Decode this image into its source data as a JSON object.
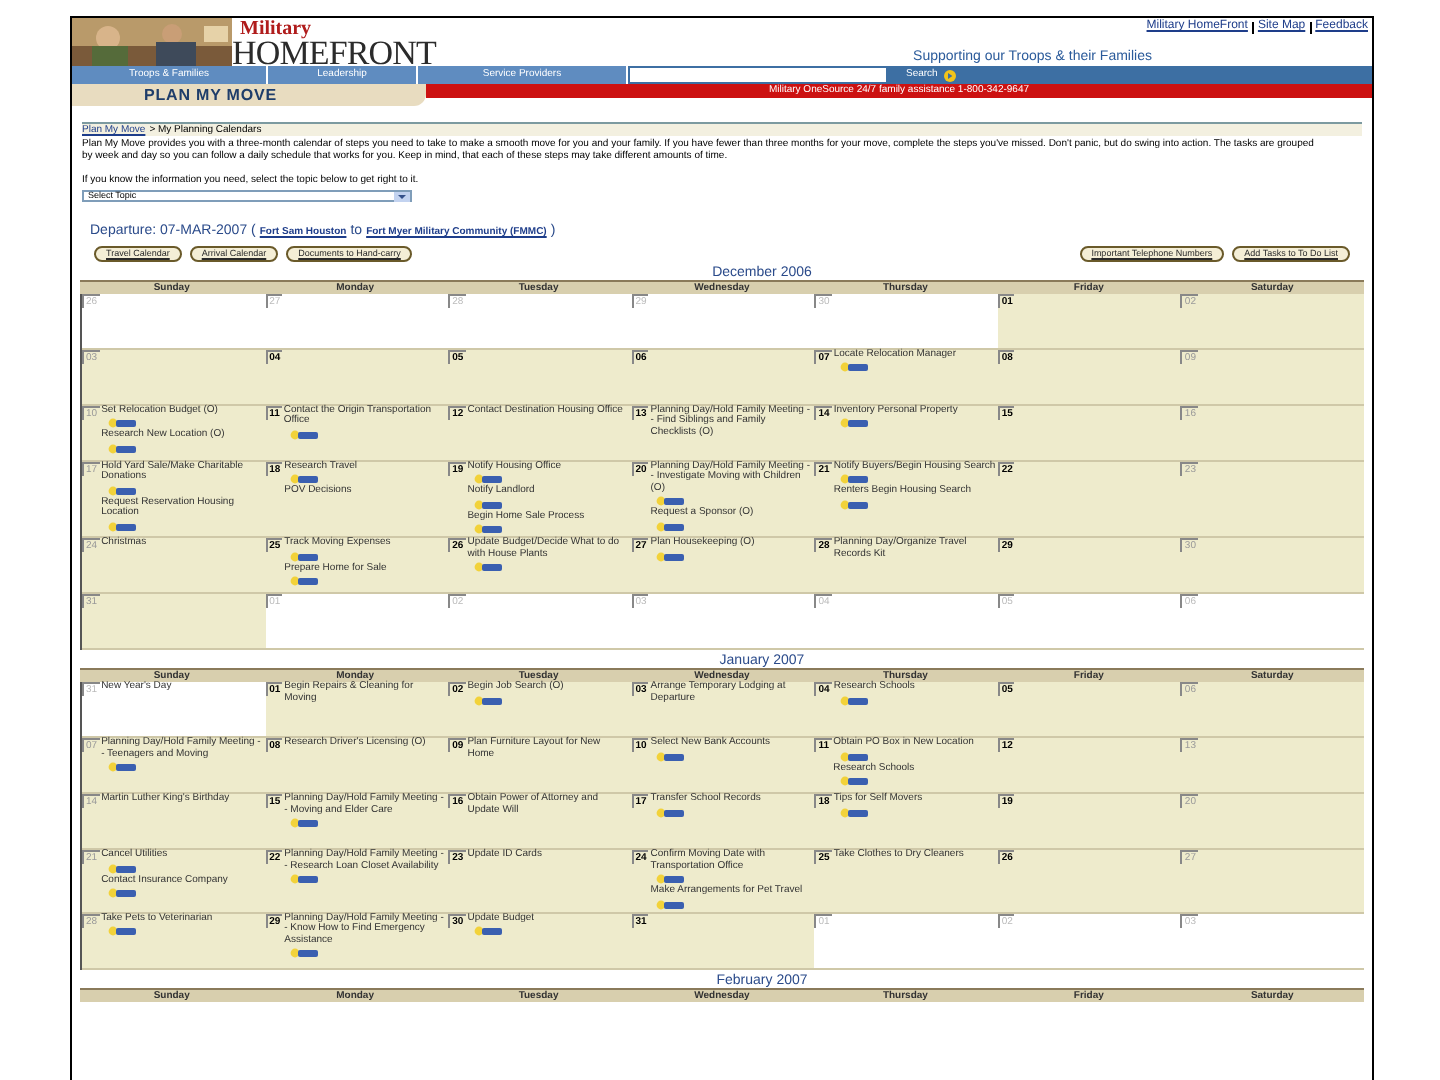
{
  "header": {
    "logo_top": "Military",
    "logo_main": "HOMEFRONT",
    "top_links": [
      "Military HomeFront",
      "Site Map",
      "Feedback"
    ],
    "tagline": "Supporting our Troops & their Families",
    "nav": [
      "Troops & Families",
      "Leadership",
      "Service Providers"
    ],
    "search_button": "Search",
    "section_title": "PLAN MY MOVE",
    "hotline": "Military OneSource 24/7 family assistance 1-800-342-9647"
  },
  "breadcrumb": {
    "link": "Plan My Move",
    "current": "> My Planning Calendars"
  },
  "intro": "Plan My Move provides you with a three-month calendar of steps you need to take to make a smooth move for you and your family. If you have fewer than three months for your move, complete the steps you've missed. Don't panic, but do swing into action. The tasks are grouped by week and day so you can follow a daily schedule that works for you. Keep in mind, that each of these steps may take different amounts of time.",
  "topic_prompt": "If you know the information you need, select the topic below to get right to it.",
  "topic_select": "Select Topic",
  "departure": {
    "label": "Departure: 07-MAR-2007 (",
    "origin": "Fort Sam Houston",
    "to": "to",
    "destination": "Fort Myer Military Community (FMMC)",
    "close": ")"
  },
  "buttons_left": [
    "Travel Calendar",
    "Arrival Calendar",
    "Documents to Hand-carry"
  ],
  "buttons_right": [
    "Important Telephone Numbers",
    "Add Tasks to To Do List"
  ],
  "calendars": [
    {
      "title": "December 2006",
      "weekdays": [
        "Sunday",
        "Monday",
        "Tuesday",
        "Wednesday",
        "Thursday",
        "Friday",
        "Saturday"
      ],
      "weeks": [
        [
          {
            "number": "26",
            "kind": "outside"
          },
          {
            "number": "27",
            "kind": "outside"
          },
          {
            "number": "28",
            "kind": "outside"
          },
          {
            "number": "29",
            "kind": "outside"
          },
          {
            "number": "30",
            "kind": "outside"
          },
          {
            "number": "01",
            "kind": "weekday"
          },
          {
            "number": "02",
            "kind": "weekend"
          }
        ],
        [
          {
            "number": "03",
            "kind": "weekend"
          },
          {
            "number": "04",
            "kind": "weekday"
          },
          {
            "number": "05",
            "kind": "weekday"
          },
          {
            "number": "06",
            "kind": "weekday"
          },
          {
            "number": "07",
            "kind": "weekday",
            "events": [
              {
                "text": "Locate Relocation Manager",
                "more": true
              }
            ]
          },
          {
            "number": "08",
            "kind": "weekday"
          },
          {
            "number": "09",
            "kind": "weekend"
          }
        ],
        [
          {
            "number": "10",
            "kind": "weekend",
            "events": [
              {
                "text": "Set Relocation Budget (O)",
                "more": true
              },
              {
                "text": "Research New Location (O)",
                "more": true
              }
            ]
          },
          {
            "number": "11",
            "kind": "weekday",
            "events": [
              {
                "text": "Contact the Origin Transportation Office",
                "more": true
              }
            ]
          },
          {
            "number": "12",
            "kind": "weekday",
            "events": [
              {
                "text": "Contact Destination Housing Office",
                "more": false
              }
            ]
          },
          {
            "number": "13",
            "kind": "weekday",
            "events": [
              {
                "text": "Planning Day/Hold Family Meeting -- Find Siblings and Family Checklists (O)",
                "more": false
              }
            ]
          },
          {
            "number": "14",
            "kind": "weekday",
            "events": [
              {
                "text": "Inventory Personal Property",
                "more": true
              }
            ]
          },
          {
            "number": "15",
            "kind": "weekday"
          },
          {
            "number": "16",
            "kind": "weekend"
          }
        ],
        [
          {
            "number": "17",
            "kind": "weekend",
            "events": [
              {
                "text": "Hold Yard Sale/Make Charitable Donations",
                "more": true
              },
              {
                "text": "Request Reservation Housing Location",
                "more": true
              }
            ]
          },
          {
            "number": "18",
            "kind": "weekday",
            "events": [
              {
                "text": "Research Travel",
                "more": true
              },
              {
                "text": "POV Decisions",
                "more": false
              }
            ]
          },
          {
            "number": "19",
            "kind": "weekday",
            "events": [
              {
                "text": "Notify Housing Office",
                "more": true
              },
              {
                "text": "Notify Landlord",
                "more": true
              },
              {
                "text": "Begin Home Sale Process",
                "more": true
              }
            ]
          },
          {
            "number": "20",
            "kind": "weekday",
            "events": [
              {
                "text": "Planning Day/Hold Family Meeting -- Investigate Moving with Children (O)",
                "more": true
              },
              {
                "text": "Request a Sponsor (O)",
                "more": true
              }
            ]
          },
          {
            "number": "21",
            "kind": "weekday",
            "events": [
              {
                "text": "Notify Buyers/Begin Housing Search",
                "more": true
              },
              {
                "text": "Renters Begin Housing Search",
                "more": true
              }
            ]
          },
          {
            "number": "22",
            "kind": "weekday"
          },
          {
            "number": "23",
            "kind": "weekend"
          }
        ],
        [
          {
            "number": "24",
            "kind": "weekend",
            "events": [
              {
                "text": "Christmas",
                "more": false
              }
            ]
          },
          {
            "number": "25",
            "kind": "weekday",
            "events": [
              {
                "text": "Track Moving Expenses",
                "more": true
              },
              {
                "text": "Prepare Home for Sale",
                "more": true
              }
            ]
          },
          {
            "number": "26",
            "kind": "weekday",
            "events": [
              {
                "text": "Update Budget/Decide What to do with House Plants",
                "more": true
              }
            ]
          },
          {
            "number": "27",
            "kind": "weekday",
            "events": [
              {
                "text": "Plan Housekeeping (O)",
                "more": true
              }
            ]
          },
          {
            "number": "28",
            "kind": "weekday",
            "events": [
              {
                "text": "Planning Day/Organize Travel Records Kit",
                "more": false
              }
            ]
          },
          {
            "number": "29",
            "kind": "weekday"
          },
          {
            "number": "30",
            "kind": "weekend"
          }
        ],
        [
          {
            "number": "31",
            "kind": "weekend"
          },
          {
            "number": "01",
            "kind": "outside"
          },
          {
            "number": "02",
            "kind": "outside"
          },
          {
            "number": "03",
            "kind": "outside"
          },
          {
            "number": "04",
            "kind": "outside"
          },
          {
            "number": "05",
            "kind": "outside"
          },
          {
            "number": "06",
            "kind": "outside"
          }
        ]
      ]
    },
    {
      "title": "January 2007",
      "weekdays": [
        "Sunday",
        "Monday",
        "Tuesday",
        "Wednesday",
        "Thursday",
        "Friday",
        "Saturday"
      ],
      "weeks": [
        [
          {
            "number": "31",
            "kind": "outside",
            "events": [
              {
                "text": "New Year's Day",
                "more": false
              }
            ]
          },
          {
            "number": "01",
            "kind": "weekday",
            "events": [
              {
                "text": "Begin Repairs & Cleaning for Moving",
                "more": false
              }
            ]
          },
          {
            "number": "02",
            "kind": "weekday",
            "events": [
              {
                "text": "Begin Job Search (O)",
                "more": true
              }
            ]
          },
          {
            "number": "03",
            "kind": "weekday",
            "events": [
              {
                "text": "Arrange Temporary Lodging at Departure",
                "more": false
              }
            ]
          },
          {
            "number": "04",
            "kind": "weekday",
            "events": [
              {
                "text": "Research Schools",
                "more": true
              }
            ]
          },
          {
            "number": "05",
            "kind": "weekday"
          },
          {
            "number": "06",
            "kind": "weekend"
          }
        ],
        [
          {
            "number": "07",
            "kind": "weekend",
            "events": [
              {
                "text": "Planning Day/Hold Family Meeting -- Teenagers and Moving",
                "more": true
              }
            ]
          },
          {
            "number": "08",
            "kind": "weekday",
            "events": [
              {
                "text": "Research Driver's Licensing (O)",
                "more": false
              }
            ]
          },
          {
            "number": "09",
            "kind": "weekday",
            "events": [
              {
                "text": "Plan Furniture Layout for New Home",
                "more": false
              }
            ]
          },
          {
            "number": "10",
            "kind": "weekday",
            "events": [
              {
                "text": "Select New Bank Accounts",
                "more": true
              }
            ]
          },
          {
            "number": "11",
            "kind": "weekday",
            "events": [
              {
                "text": "Obtain PO Box in New Location",
                "more": true
              },
              {
                "text": "Research Schools",
                "more": true
              }
            ]
          },
          {
            "number": "12",
            "kind": "weekday"
          },
          {
            "number": "13",
            "kind": "weekend"
          }
        ],
        [
          {
            "number": "14",
            "kind": "weekend",
            "events": [
              {
                "text": "Martin Luther King's Birthday",
                "more": false
              }
            ]
          },
          {
            "number": "15",
            "kind": "weekday",
            "events": [
              {
                "text": "Planning Day/Hold Family Meeting -- Moving and Elder Care",
                "more": true
              }
            ]
          },
          {
            "number": "16",
            "kind": "weekday",
            "events": [
              {
                "text": "Obtain Power of Attorney and Update Will",
                "more": false
              }
            ]
          },
          {
            "number": "17",
            "kind": "weekday",
            "events": [
              {
                "text": "Transfer School Records",
                "more": true
              }
            ]
          },
          {
            "number": "18",
            "kind": "weekday",
            "events": [
              {
                "text": "Tips for Self Movers",
                "more": true
              }
            ]
          },
          {
            "number": "19",
            "kind": "weekday"
          },
          {
            "number": "20",
            "kind": "weekend"
          }
        ],
        [
          {
            "number": "21",
            "kind": "weekend",
            "events": [
              {
                "text": "Cancel Utilities",
                "more": true
              },
              {
                "text": "Contact Insurance Company",
                "more": true
              }
            ]
          },
          {
            "number": "22",
            "kind": "weekday",
            "events": [
              {
                "text": "Planning Day/Hold Family Meeting -- Research Loan Closet Availability",
                "more": true
              }
            ]
          },
          {
            "number": "23",
            "kind": "weekday",
            "events": [
              {
                "text": "Update ID Cards",
                "more": false
              }
            ]
          },
          {
            "number": "24",
            "kind": "weekday",
            "events": [
              {
                "text": "Confirm Moving Date with Transportation Office",
                "more": true
              },
              {
                "text": "Make Arrangements for Pet Travel",
                "more": true
              }
            ]
          },
          {
            "number": "25",
            "kind": "weekday",
            "events": [
              {
                "text": "Take Clothes to Dry Cleaners",
                "more": false
              }
            ]
          },
          {
            "number": "26",
            "kind": "weekday"
          },
          {
            "number": "27",
            "kind": "weekend"
          }
        ],
        [
          {
            "number": "28",
            "kind": "weekend",
            "events": [
              {
                "text": "Take Pets to Veterinarian",
                "more": true
              }
            ]
          },
          {
            "number": "29",
            "kind": "weekday",
            "events": [
              {
                "text": "Planning Day/Hold Family Meeting -- Know How to Find Emergency Assistance",
                "more": true
              }
            ]
          },
          {
            "number": "30",
            "kind": "weekday",
            "events": [
              {
                "text": "Update Budget",
                "more": true
              }
            ]
          },
          {
            "number": "31",
            "kind": "weekday"
          },
          {
            "number": "01",
            "kind": "outside"
          },
          {
            "number": "02",
            "kind": "outside"
          },
          {
            "number": "03",
            "kind": "outside"
          }
        ]
      ]
    },
    {
      "title": "February 2007",
      "weekdays": [
        "Sunday",
        "Monday",
        "Tuesday",
        "Wednesday",
        "Thursday",
        "Friday",
        "Saturday"
      ]
    }
  ]
}
